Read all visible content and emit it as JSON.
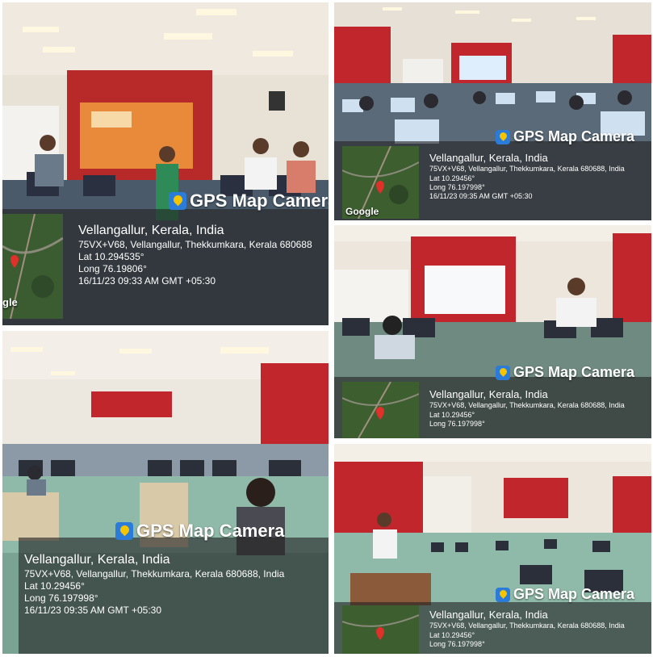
{
  "tiles": [
    {
      "brand": "GPS Map Camera",
      "location": "Vellangallur, Kerala, India",
      "address": "75VX+V68, Vellangallur, Thekkumkara, Kerala 680688",
      "lat": "Lat 10.294535°",
      "long": "Long 76.19806°",
      "datetime": "16/11/23 09:33 AM GMT +05:30",
      "google": "gle"
    },
    {
      "brand": "GPS Map Camera",
      "location": "Vellangallur, Kerala, India",
      "address": "75VX+V68, Vellangallur, Thekkumkara, Kerala 680688, India",
      "lat": "Lat 10.29456°",
      "long": "Long 76.197998°",
      "datetime": "16/11/23 09:35 AM GMT +05:30",
      "google": "Google"
    },
    {
      "brand": "GPS Map Camera",
      "location": "Vellangallur, Kerala, India",
      "address": "75VX+V68, Vellangallur, Thekkumkara, Kerala 680688, India",
      "lat": "Lat 10.29456°",
      "long": "Long 76.197998°",
      "datetime": "",
      "google": ""
    },
    {
      "brand": "GPS Map Camera",
      "location": "Vellangallur, Kerala, India",
      "address": "75VX+V68, Vellangallur, Thekkumkara, Kerala 680688, India",
      "lat": "Lat 10.29456°",
      "long": "Long 76.197998°",
      "datetime": "16/11/23 09:35 AM GMT +05:30",
      "google": ""
    },
    {
      "brand": "GPS Map Camera",
      "location": "Vellangallur, Kerala, India",
      "address": "75VX+V68, Vellangallur, Thekkumkara, Kerala 680688, India",
      "lat": "Lat 10.29456°",
      "long": "Long 76.197998°",
      "datetime": "",
      "google": ""
    }
  ],
  "colors": {
    "wall_red": "#c0262c",
    "desk_green": "#8fb9a8",
    "monitor": "#1b1f2a",
    "overlay": "#232323"
  },
  "icons": {
    "brand_logo": "gps-map-camera-logo-icon",
    "pin": "map-pin-icon"
  }
}
